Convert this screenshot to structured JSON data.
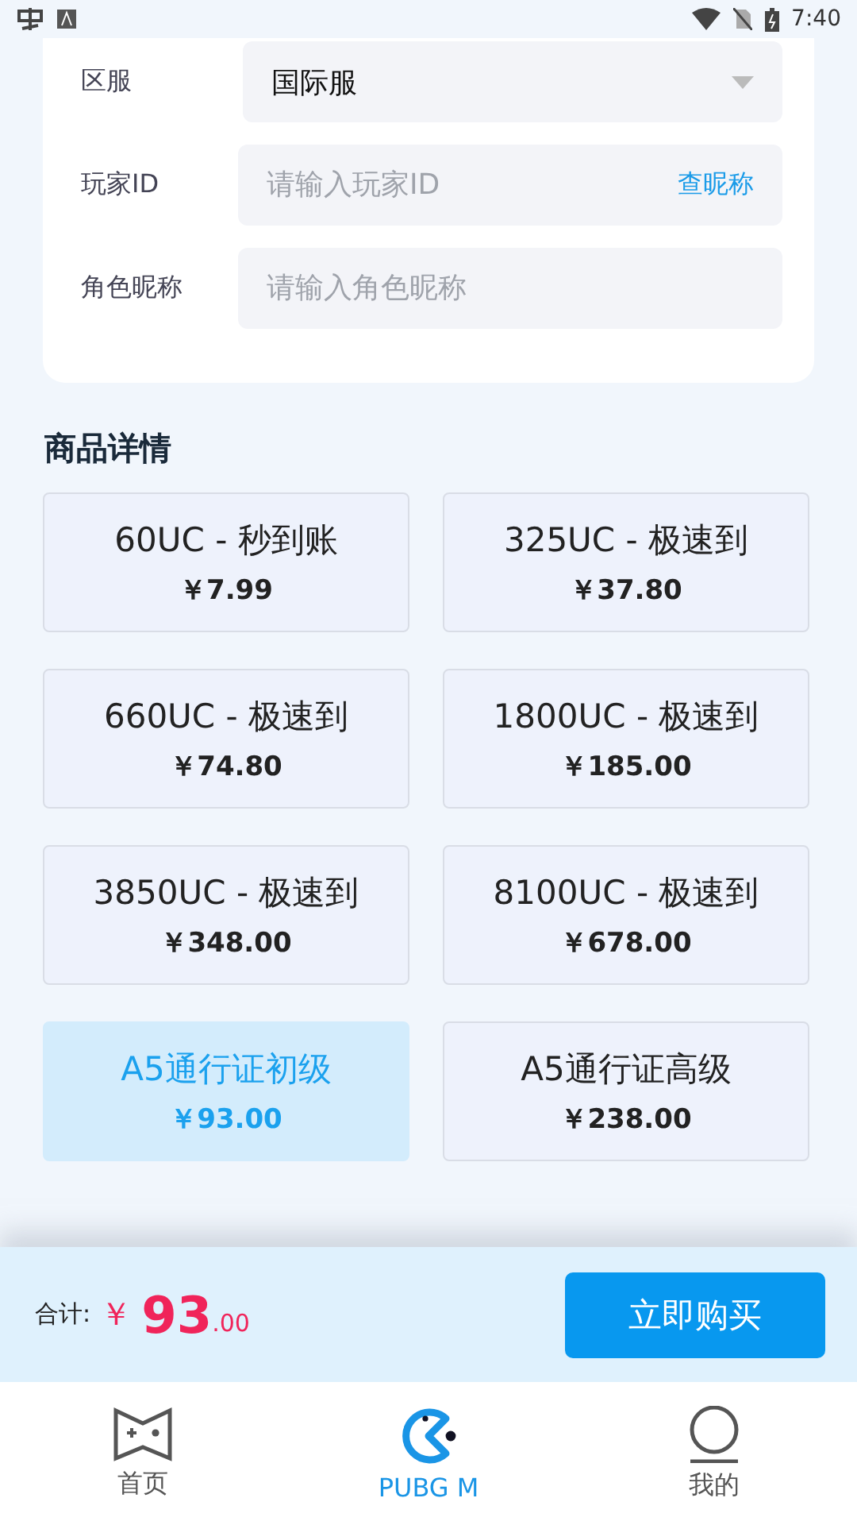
{
  "status_bar": {
    "time": "7:40"
  },
  "form": {
    "rows": [
      {
        "kind": "select",
        "label": "区服",
        "value": "国际服"
      },
      {
        "kind": "input",
        "label": "玩家ID",
        "placeholder": "请输入玩家ID",
        "action": "查昵称"
      },
      {
        "kind": "input",
        "label": "角色昵称",
        "placeholder": "请输入角色昵称"
      }
    ]
  },
  "section_title": "商品详情",
  "products": [
    {
      "name": "60UC - 秒到账",
      "price": "￥7.99",
      "selected": false
    },
    {
      "name": "325UC - 极速到",
      "price": "￥37.80",
      "selected": false
    },
    {
      "name": "660UC - 极速到",
      "price": "￥74.80",
      "selected": false
    },
    {
      "name": "1800UC - 极速到",
      "price": "￥185.00",
      "selected": false
    },
    {
      "name": "3850UC - 极速到",
      "price": "￥348.00",
      "selected": false
    },
    {
      "name": "8100UC - 极速到",
      "price": "￥678.00",
      "selected": false
    },
    {
      "name": "A5通行证初级",
      "price": "￥93.00",
      "selected": true
    },
    {
      "name": "A5通行证高级",
      "price": "￥238.00",
      "selected": false
    }
  ],
  "footer": {
    "total_label": "合计:",
    "currency": "￥",
    "amount": "93",
    "decimals": ".00",
    "buy_button": "立即购买"
  },
  "tab_bar": [
    {
      "kind": "home",
      "label": "首页",
      "selected": false
    },
    {
      "kind": "game",
      "label": "PUBG M",
      "selected": true
    },
    {
      "kind": "profile",
      "label": "我的",
      "selected": false
    }
  ]
}
